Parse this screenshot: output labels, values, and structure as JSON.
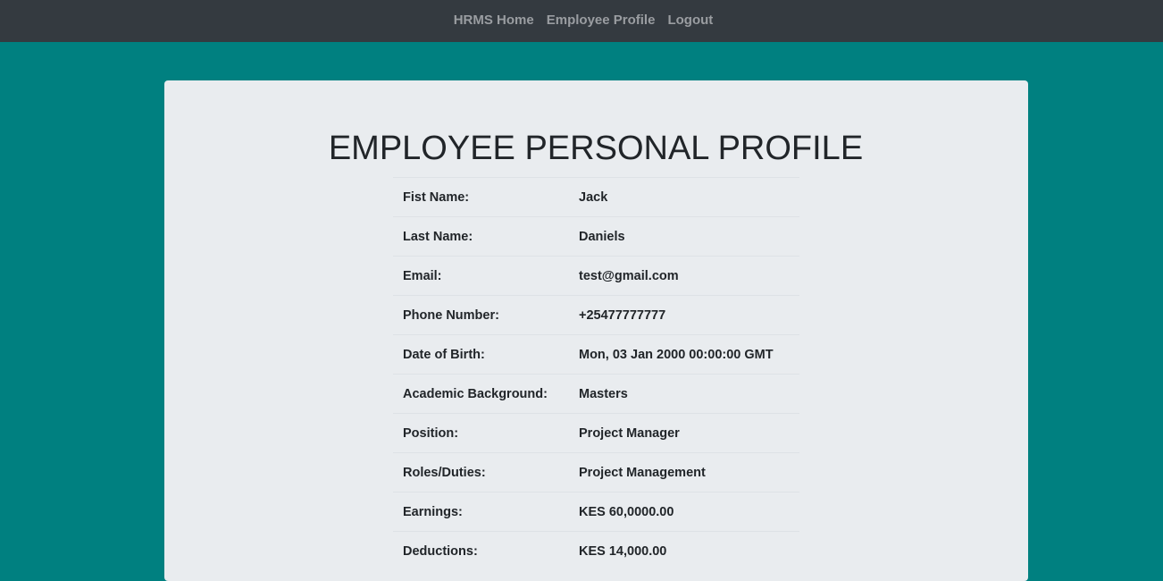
{
  "nav": {
    "items": [
      {
        "label": "HRMS Home"
      },
      {
        "label": "Employee Profile"
      },
      {
        "label": "Logout"
      }
    ]
  },
  "page": {
    "title": "EMPLOYEE PERSONAL PROFILE"
  },
  "profile": {
    "rows": [
      {
        "label": "Fist Name:",
        "value": "Jack"
      },
      {
        "label": "Last Name:",
        "value": "Daniels"
      },
      {
        "label": "Email:",
        "value": "test@gmail.com"
      },
      {
        "label": "Phone Number:",
        "value": "+25477777777"
      },
      {
        "label": "Date of Birth:",
        "value": "Mon, 03 Jan 2000 00:00:00 GMT"
      },
      {
        "label": "Academic Background:",
        "value": "Masters"
      },
      {
        "label": "Position:",
        "value": "Project Manager"
      },
      {
        "label": "Roles/Duties:",
        "value": "Project Management"
      },
      {
        "label": "Earnings:",
        "value": "KES 60,0000.00"
      },
      {
        "label": "Deductions:",
        "value": "KES 14,000.00"
      }
    ]
  },
  "colors": {
    "background": "#008080",
    "navbar": "#343a40",
    "card": "#e9ecef",
    "nav_link": "#9a9da1",
    "text": "#212529"
  }
}
